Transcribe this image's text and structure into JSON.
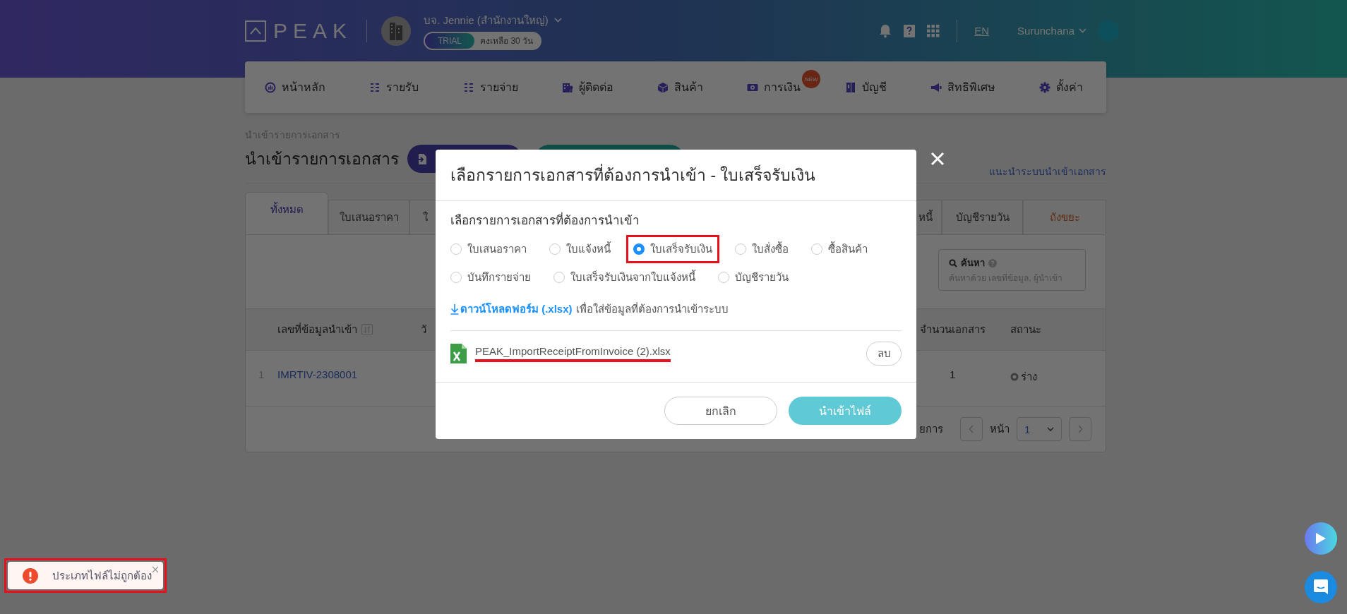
{
  "header": {
    "logo": "PEAK",
    "company": "บจ. Jennie (สำนักงานใหญ่)",
    "plan_badge": "TRIAL",
    "plan_remaining": "คงเหลือ 30 วัน",
    "language": "EN",
    "user": "Surunchana"
  },
  "nav": [
    {
      "label": "หน้าหลัก"
    },
    {
      "label": "รายรับ"
    },
    {
      "label": "รายจ่าย"
    },
    {
      "label": "ผู้ติดต่อ"
    },
    {
      "label": "สินค้า"
    },
    {
      "label": "การเงิน",
      "badge": "NEW"
    },
    {
      "label": "บัญชี"
    },
    {
      "label": "สิทธิพิเศษ"
    },
    {
      "label": "ตั้งค่า"
    }
  ],
  "page": {
    "breadcrumb": "นำเข้ารายการเอกสาร",
    "title": "นำเข้ารายการเอกสาร",
    "guide_link": "แนะนำระบบนำเข้าเอกสาร"
  },
  "tabs": [
    {
      "label": "ทั้งหมด",
      "selected": true,
      "kind": "normal"
    },
    {
      "label": "ใบเสนอราคา",
      "selected": false,
      "kind": "normal"
    },
    {
      "label": "ใ",
      "selected": false,
      "kind": "cut-right"
    },
    {
      "label": "หนี้",
      "selected": false,
      "kind": "cut-left"
    },
    {
      "label": "บัญชีรายวัน",
      "selected": false,
      "kind": "normal"
    },
    {
      "label": "ถังขยะ",
      "selected": false,
      "kind": "trash"
    }
  ],
  "search": {
    "label": "ค้นหา",
    "placeholder": "ค้นหาด้วย เลขที่ข้อมูล, ผู้นำเข้า"
  },
  "table": {
    "columns": [
      "เลขที่ข้อมูลนำเข้า",
      "วั",
      "จำนวนเอกสาร",
      "สถานะ"
    ],
    "rows": [
      {
        "index": "1",
        "id": "IMRTIV-2308001",
        "count": "1",
        "status": "ร่าง"
      }
    ]
  },
  "pagination": {
    "summary": "ยการ",
    "page_label": "หน้า",
    "page": "1"
  },
  "modal": {
    "title": "เลือกรายการเอกสารที่ต้องการนำเข้า - ใบเสร็จรับเงิน",
    "section_label": "เลือกรายการเอกสารที่ต้องการนำเข้า",
    "options": [
      {
        "label": "ใบเสนอราคา",
        "selected": false,
        "highlighted": false
      },
      {
        "label": "ใบแจ้งหนี้",
        "selected": false,
        "highlighted": false
      },
      {
        "label": "ใบเสร็จรับเงิน",
        "selected": true,
        "highlighted": true
      },
      {
        "label": "ใบสั่งซื้อ",
        "selected": false,
        "highlighted": false
      },
      {
        "label": "ซื้อสินค้า",
        "selected": false,
        "highlighted": false
      },
      {
        "label": "บันทึกรายจ่าย",
        "selected": false,
        "highlighted": false
      },
      {
        "label": "ใบเสร็จรับเงินจากใบแจ้งหนี้",
        "selected": false,
        "highlighted": false
      },
      {
        "label": "บัญชีรายวัน",
        "selected": false,
        "highlighted": false
      }
    ],
    "download_link": "ดาวน์โหลดฟอร์ม (.xlsx)",
    "download_note": "เพื่อใส่ข้อมูลที่ต้องการนำเข้าระบบ",
    "file": {
      "name": "PEAK_ImportReceiptFromInvoice (2).xlsx",
      "underlined": true
    },
    "delete_button": "ลบ",
    "cancel_button": "ยกเลิก",
    "import_button": "นำเข้าไฟล์"
  },
  "toast": {
    "message": "ประเภทไฟล์ไม่ถูกต้อง",
    "highlighted": true
  }
}
